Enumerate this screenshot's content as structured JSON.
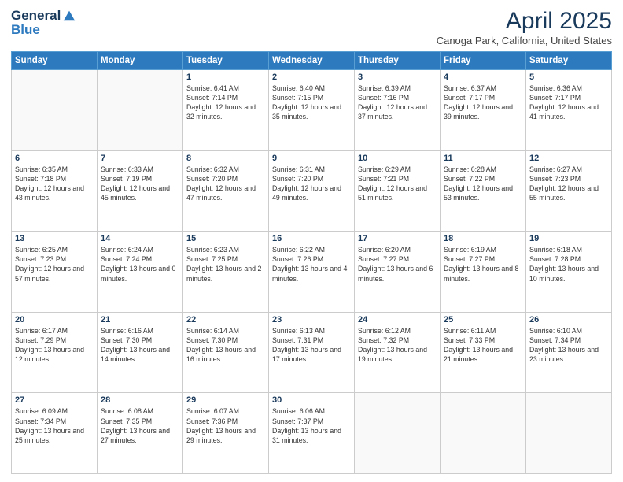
{
  "header": {
    "logo_general": "General",
    "logo_blue": "Blue",
    "month_title": "April 2025",
    "subtitle": "Canoga Park, California, United States"
  },
  "days_of_week": [
    "Sunday",
    "Monday",
    "Tuesday",
    "Wednesday",
    "Thursday",
    "Friday",
    "Saturday"
  ],
  "weeks": [
    [
      {
        "day": "",
        "info": ""
      },
      {
        "day": "",
        "info": ""
      },
      {
        "day": "1",
        "info": "Sunrise: 6:41 AM\nSunset: 7:14 PM\nDaylight: 12 hours and 32 minutes."
      },
      {
        "day": "2",
        "info": "Sunrise: 6:40 AM\nSunset: 7:15 PM\nDaylight: 12 hours and 35 minutes."
      },
      {
        "day": "3",
        "info": "Sunrise: 6:39 AM\nSunset: 7:16 PM\nDaylight: 12 hours and 37 minutes."
      },
      {
        "day": "4",
        "info": "Sunrise: 6:37 AM\nSunset: 7:17 PM\nDaylight: 12 hours and 39 minutes."
      },
      {
        "day": "5",
        "info": "Sunrise: 6:36 AM\nSunset: 7:17 PM\nDaylight: 12 hours and 41 minutes."
      }
    ],
    [
      {
        "day": "6",
        "info": "Sunrise: 6:35 AM\nSunset: 7:18 PM\nDaylight: 12 hours and 43 minutes."
      },
      {
        "day": "7",
        "info": "Sunrise: 6:33 AM\nSunset: 7:19 PM\nDaylight: 12 hours and 45 minutes."
      },
      {
        "day": "8",
        "info": "Sunrise: 6:32 AM\nSunset: 7:20 PM\nDaylight: 12 hours and 47 minutes."
      },
      {
        "day": "9",
        "info": "Sunrise: 6:31 AM\nSunset: 7:20 PM\nDaylight: 12 hours and 49 minutes."
      },
      {
        "day": "10",
        "info": "Sunrise: 6:29 AM\nSunset: 7:21 PM\nDaylight: 12 hours and 51 minutes."
      },
      {
        "day": "11",
        "info": "Sunrise: 6:28 AM\nSunset: 7:22 PM\nDaylight: 12 hours and 53 minutes."
      },
      {
        "day": "12",
        "info": "Sunrise: 6:27 AM\nSunset: 7:23 PM\nDaylight: 12 hours and 55 minutes."
      }
    ],
    [
      {
        "day": "13",
        "info": "Sunrise: 6:25 AM\nSunset: 7:23 PM\nDaylight: 12 hours and 57 minutes."
      },
      {
        "day": "14",
        "info": "Sunrise: 6:24 AM\nSunset: 7:24 PM\nDaylight: 13 hours and 0 minutes."
      },
      {
        "day": "15",
        "info": "Sunrise: 6:23 AM\nSunset: 7:25 PM\nDaylight: 13 hours and 2 minutes."
      },
      {
        "day": "16",
        "info": "Sunrise: 6:22 AM\nSunset: 7:26 PM\nDaylight: 13 hours and 4 minutes."
      },
      {
        "day": "17",
        "info": "Sunrise: 6:20 AM\nSunset: 7:27 PM\nDaylight: 13 hours and 6 minutes."
      },
      {
        "day": "18",
        "info": "Sunrise: 6:19 AM\nSunset: 7:27 PM\nDaylight: 13 hours and 8 minutes."
      },
      {
        "day": "19",
        "info": "Sunrise: 6:18 AM\nSunset: 7:28 PM\nDaylight: 13 hours and 10 minutes."
      }
    ],
    [
      {
        "day": "20",
        "info": "Sunrise: 6:17 AM\nSunset: 7:29 PM\nDaylight: 13 hours and 12 minutes."
      },
      {
        "day": "21",
        "info": "Sunrise: 6:16 AM\nSunset: 7:30 PM\nDaylight: 13 hours and 14 minutes."
      },
      {
        "day": "22",
        "info": "Sunrise: 6:14 AM\nSunset: 7:30 PM\nDaylight: 13 hours and 16 minutes."
      },
      {
        "day": "23",
        "info": "Sunrise: 6:13 AM\nSunset: 7:31 PM\nDaylight: 13 hours and 17 minutes."
      },
      {
        "day": "24",
        "info": "Sunrise: 6:12 AM\nSunset: 7:32 PM\nDaylight: 13 hours and 19 minutes."
      },
      {
        "day": "25",
        "info": "Sunrise: 6:11 AM\nSunset: 7:33 PM\nDaylight: 13 hours and 21 minutes."
      },
      {
        "day": "26",
        "info": "Sunrise: 6:10 AM\nSunset: 7:34 PM\nDaylight: 13 hours and 23 minutes."
      }
    ],
    [
      {
        "day": "27",
        "info": "Sunrise: 6:09 AM\nSunset: 7:34 PM\nDaylight: 13 hours and 25 minutes."
      },
      {
        "day": "28",
        "info": "Sunrise: 6:08 AM\nSunset: 7:35 PM\nDaylight: 13 hours and 27 minutes."
      },
      {
        "day": "29",
        "info": "Sunrise: 6:07 AM\nSunset: 7:36 PM\nDaylight: 13 hours and 29 minutes."
      },
      {
        "day": "30",
        "info": "Sunrise: 6:06 AM\nSunset: 7:37 PM\nDaylight: 13 hours and 31 minutes."
      },
      {
        "day": "",
        "info": ""
      },
      {
        "day": "",
        "info": ""
      },
      {
        "day": "",
        "info": ""
      }
    ]
  ]
}
